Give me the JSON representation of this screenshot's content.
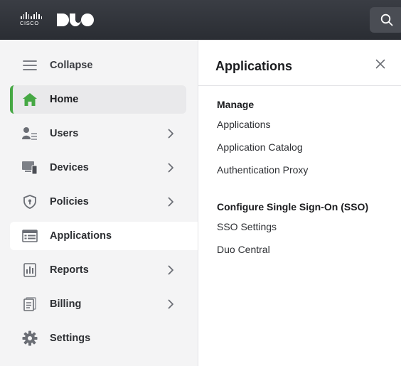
{
  "header": {
    "cisco_logo_text": "CISCO",
    "duo_logo_text": "DUO",
    "search_icon": "search-icon"
  },
  "sidebar": {
    "collapse_label": "Collapse",
    "items": [
      {
        "label": "Home",
        "icon": "home-icon",
        "has_children": false,
        "state": "active"
      },
      {
        "label": "Users",
        "icon": "users-icon",
        "has_children": true
      },
      {
        "label": "Devices",
        "icon": "devices-icon",
        "has_children": true
      },
      {
        "label": "Policies",
        "icon": "shield-icon",
        "has_children": true
      },
      {
        "label": "Applications",
        "icon": "applications-icon",
        "has_children": false,
        "state": "selected"
      },
      {
        "label": "Reports",
        "icon": "reports-icon",
        "has_children": true
      },
      {
        "label": "Billing",
        "icon": "billing-icon",
        "has_children": true
      },
      {
        "label": "Settings",
        "icon": "gear-icon",
        "has_children": false
      }
    ]
  },
  "panel": {
    "title": "Applications",
    "sections": [
      {
        "title": "Manage",
        "links": [
          "Applications",
          "Application Catalog",
          "Authentication Proxy"
        ]
      },
      {
        "title": "Configure Single Sign-On (SSO)",
        "links": [
          "SSO Settings",
          "Duo Central"
        ]
      }
    ]
  },
  "colors": {
    "topbar": "#2f3238",
    "active_accent": "#46a844",
    "home_icon": "#46a844",
    "icon_gray": "#6b6e75",
    "sidebar_bg": "#f4f4f5",
    "panel_bg": "#ffffff"
  }
}
